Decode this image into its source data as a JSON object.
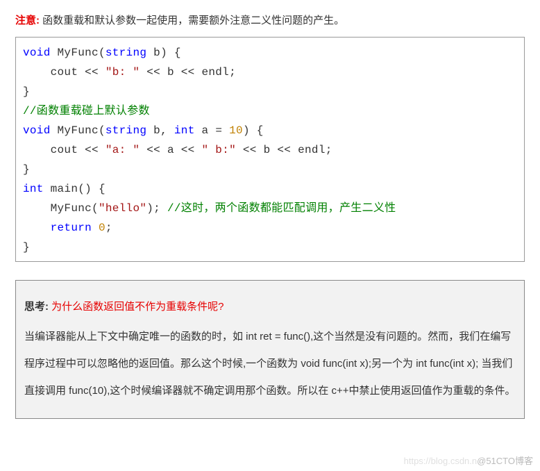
{
  "notice": {
    "label": "注意:",
    "text": " 函数重载和默认参数一起使用，需要额外注意二义性问题的产生。"
  },
  "code": {
    "l1": {
      "void": "void",
      "fn": "MyFunc",
      "lp": "(",
      "string": "string",
      "b": " b",
      "rp": ")",
      "lbr": " {"
    },
    "l2": {
      "indent": "    ",
      "cout": "cout",
      "op1": " << ",
      "str": "\"b: \"",
      "op2": " << ",
      "b": "b",
      "op3": " << ",
      "endl": "endl",
      "semi": ";"
    },
    "l3": {
      "rbr": "}"
    },
    "l4": {
      "cmt": "//函数重载碰上默认参数"
    },
    "l5": {
      "void": "void",
      "fn": "MyFunc",
      "lp": "(",
      "string": "string",
      "b": " b",
      "comma": ", ",
      "int": "int",
      "a": " a",
      "eq": " = ",
      "ten": "10",
      "rp": ")",
      "lbr": " {"
    },
    "l6": {
      "indent": "    ",
      "cout": "cout",
      "op1": " << ",
      "str1": "\"a: \"",
      "op2": " << ",
      "a": "a",
      "op3": " << ",
      "str2": "\" b:\"",
      "op4": " << ",
      "b": "b",
      "op5": " << ",
      "endl": "endl",
      "semi": ";"
    },
    "l7": {
      "rbr": "}"
    },
    "l8": {
      "int": "int",
      "main": " main",
      "lp": "(",
      "rp": ")",
      "lbr": " {"
    },
    "l9": {
      "indent": "    ",
      "fn": "MyFunc",
      "lp": "(",
      "str": "\"hello\"",
      "rp": ")",
      "semi": ";",
      "sp": " ",
      "cmt": "//这时，两个函数都能匹配调用，产生二义性"
    },
    "l10": {
      "indent": "    ",
      "return": "return",
      "sp": " ",
      "zero": "0",
      "semi": ";"
    },
    "l11": {
      "rbr": "}"
    }
  },
  "think": {
    "label": "思考:",
    "question": "  为什么函数返回值不作为重载条件呢?",
    "body": "当编译器能从上下文中确定唯一的函数的时，如 int ret = func(),这个当然是没有问题的。然而，我们在编写程序过程中可以忽略他的返回值。那么这个时候,一个函数为 void func(int x);另一个为 int func(int x);  当我们直接调用 func(10),这个时候编译器就不确定调用那个函数。所以在 c++中禁止使用返回值作为重载的条件。"
  },
  "watermark": {
    "faint": "https://blog.csdn.n",
    "at": "@51CTO博客"
  }
}
